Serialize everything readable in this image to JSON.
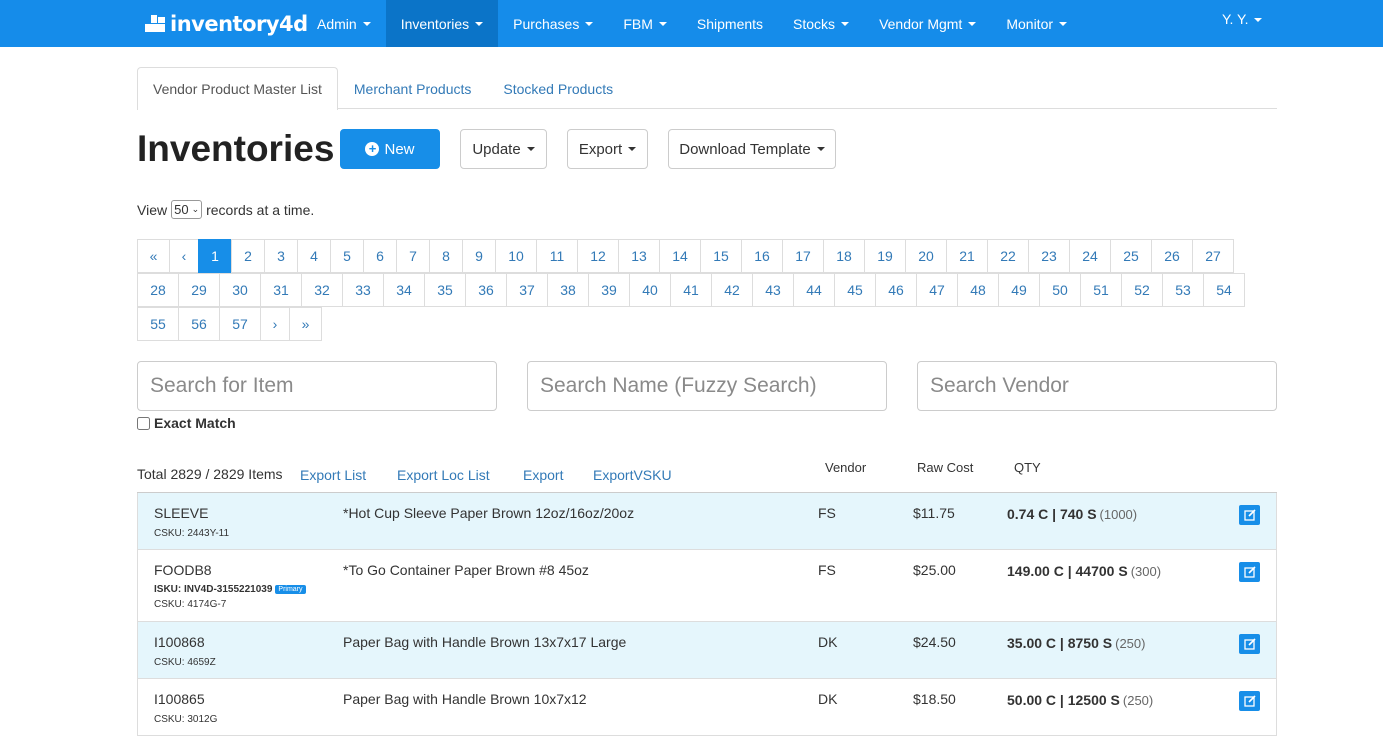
{
  "navbar": {
    "brand": "inventory4d",
    "items": [
      {
        "label": "Admin",
        "dropdown": true,
        "active": false
      },
      {
        "label": "Inventories",
        "dropdown": true,
        "active": true
      },
      {
        "label": "Purchases",
        "dropdown": true,
        "active": false
      },
      {
        "label": "FBM",
        "dropdown": true,
        "active": false
      },
      {
        "label": "Shipments",
        "dropdown": false,
        "active": false
      },
      {
        "label": "Stocks",
        "dropdown": true,
        "active": false
      },
      {
        "label": "Vendor Mgmt",
        "dropdown": true,
        "active": false
      },
      {
        "label": "Monitor",
        "dropdown": true,
        "active": false
      }
    ],
    "user": "Y. Y.",
    "color": "#158cea",
    "active_color": "#0b74c8"
  },
  "tabs": [
    {
      "label": "Vendor Product Master List",
      "active": true
    },
    {
      "label": "Merchant Products",
      "active": false
    },
    {
      "label": "Stocked Products",
      "active": false
    }
  ],
  "page": {
    "title": "Inventories",
    "new_label": "New",
    "update_label": "Update",
    "export_label": "Export",
    "download_template_label": "Download Template"
  },
  "view": {
    "prefix": "View",
    "value": "50",
    "suffix": "records at a time."
  },
  "pagination": {
    "first": "«",
    "prev": "‹",
    "next": "›",
    "last": "»",
    "current": 1,
    "total_pages": 57
  },
  "search": {
    "item_placeholder": "Search for Item",
    "name_placeholder": "Search Name (Fuzzy Search)",
    "vendor_placeholder": "Search Vendor",
    "exact_match_label": "Exact Match"
  },
  "list": {
    "total_text": "Total 2829 / 2829 Items",
    "links": [
      "Export List",
      "Export Loc List",
      "Export",
      "ExportVSKU"
    ],
    "columns": {
      "vendor": "Vendor",
      "raw_cost": "Raw Cost",
      "qty": "QTY"
    },
    "rows": [
      {
        "sku": "SLEEVE",
        "isku": "",
        "badge": "",
        "csku": "CSKU: 2443Y-11",
        "name": "*Hot Cup Sleeve Paper Brown 12oz/16oz/20oz",
        "vendor": "FS",
        "cost": "$11.75",
        "qty": "0.74 C | 740 S",
        "qty_sub": "(1000)",
        "highlight": true
      },
      {
        "sku": "FOODB8",
        "isku": "ISKU: INV4D-3155221039",
        "badge": "Primary",
        "csku": "CSKU: 4174G-7",
        "name": "*To Go Container Paper Brown #8 45oz",
        "vendor": "FS",
        "cost": "$25.00",
        "qty": "149.00 C | 44700 S",
        "qty_sub": "(300)",
        "highlight": false
      },
      {
        "sku": "I100868",
        "isku": "",
        "badge": "",
        "csku": "CSKU: 4659Z",
        "name": "Paper Bag with Handle Brown 13x7x17 Large",
        "vendor": "DK",
        "cost": "$24.50",
        "qty": "35.00 C | 8750 S",
        "qty_sub": "(250)",
        "highlight": true
      },
      {
        "sku": "I100865",
        "isku": "",
        "badge": "",
        "csku": "CSKU: 3012G",
        "name": "Paper Bag with Handle Brown 10x7x12",
        "vendor": "DK",
        "cost": "$18.50",
        "qty": "50.00 C | 12500 S",
        "qty_sub": "(250)",
        "highlight": false
      }
    ]
  },
  "icons": {
    "new": "plus-circle-icon",
    "edit": "edit-icon",
    "brand": "logo-icon"
  }
}
